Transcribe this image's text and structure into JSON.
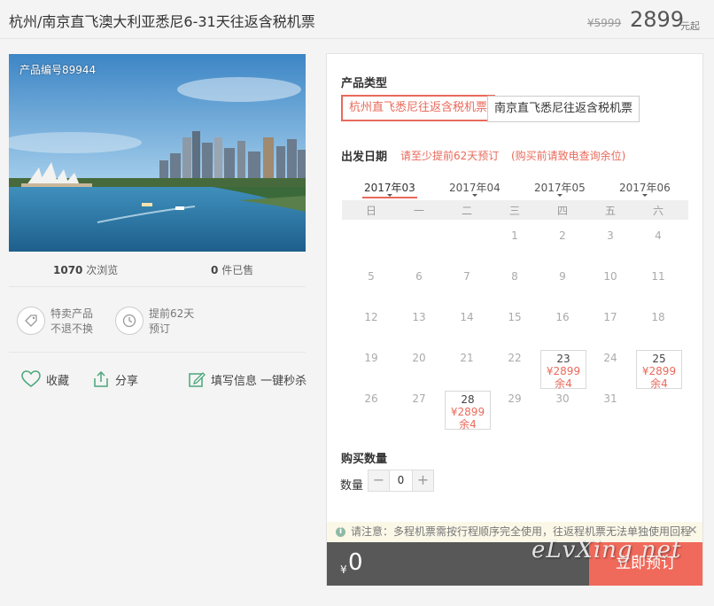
{
  "header": {
    "title": "杭州/南京直飞澳大利亚悉尼6-31天往返含税机票",
    "original_price": "¥5999",
    "price": "2899",
    "price_unit": "元起"
  },
  "product": {
    "product_no": "产品编号89944",
    "views_count": "1070",
    "views_label": "次浏览",
    "sold_count": "0",
    "sold_label": "件已售"
  },
  "features": [
    {
      "icon": "tag-icon",
      "line1": "特卖产品",
      "line2": "不退不换"
    },
    {
      "icon": "clock-icon",
      "line1": "提前62天",
      "line2": "预订"
    }
  ],
  "actions": {
    "favorite": "收藏",
    "share": "分享",
    "fill_info": "填写信息 一键秒杀"
  },
  "booking": {
    "type_label": "产品类型",
    "types": [
      "杭州直飞悉尼往返含税机票",
      "南京直飞悉尼往返含税机票"
    ],
    "active_type_index": 0,
    "date_label": "出发日期",
    "date_note1": "请至少提前62天预订",
    "date_note2": "(购买前请致电查询余位)",
    "months": [
      "2017年03",
      "2017年04",
      "2017年05",
      "2017年06"
    ],
    "active_month_index": 0,
    "weekdays": [
      "日",
      "一",
      "二",
      "三",
      "四",
      "五",
      "六"
    ],
    "days": [
      "1",
      "2",
      "3",
      "4",
      "5",
      "6",
      "7",
      "8",
      "9",
      "10",
      "11",
      "12",
      "13",
      "14",
      "15",
      "16",
      "17",
      "18",
      "19",
      "20",
      "21",
      "22",
      "23",
      "24",
      "25",
      "26",
      "27",
      "28",
      "29",
      "30",
      "31"
    ],
    "available": [
      {
        "day": "23",
        "price": "¥2899",
        "remain": "余4"
      },
      {
        "day": "25",
        "price": "¥2899",
        "remain": "余4"
      },
      {
        "day": "28",
        "price": "¥2899",
        "remain": "余4"
      }
    ],
    "quantity_title": "购买数量",
    "quantity_label": "数量",
    "quantity_value": "0",
    "minus": "−",
    "plus": "+"
  },
  "notice": {
    "icon": "info-icon",
    "text": "请注意：多程机票需按行程顺序完全使用，往返程机票无法单独使用回程",
    "close": "✕"
  },
  "footer": {
    "currency": "¥",
    "total": "0",
    "buy_label": "立即预订"
  },
  "watermark": "eLvXing.net",
  "colors": {
    "accent": "#e96a5b",
    "buy_button": "#f06a5b",
    "footer_bar": "#585858"
  }
}
